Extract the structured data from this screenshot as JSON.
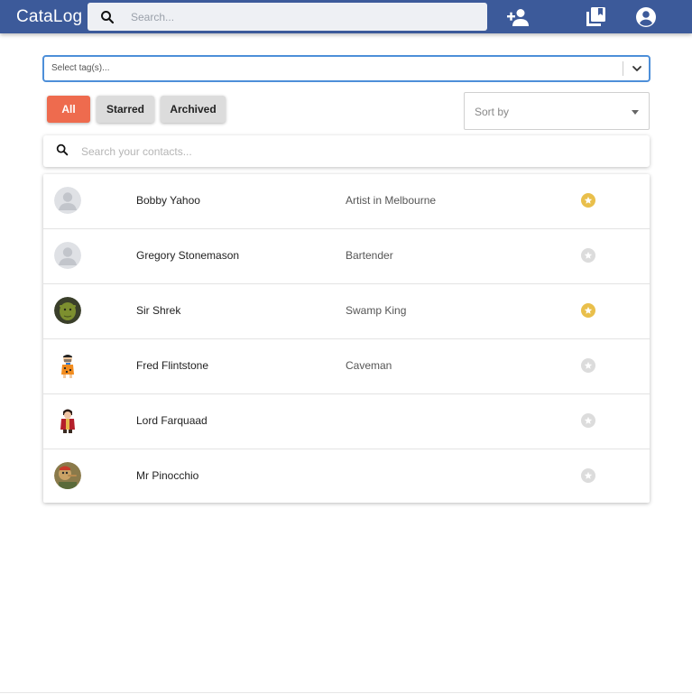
{
  "app": {
    "brand": "CataLog"
  },
  "header": {
    "search_placeholder": "Search...",
    "icons": [
      "add-contact-icon",
      "library-icon",
      "account-circle-icon"
    ]
  },
  "tag_select": {
    "placeholder": "Select tag(s)..."
  },
  "filters": {
    "all": "All",
    "starred": "Starred",
    "archived": "Archived",
    "active": "All"
  },
  "sort": {
    "label": "Sort by"
  },
  "contact_search": {
    "placeholder": "Search your contacts..."
  },
  "contacts": [
    {
      "name": "Bobby Yahoo",
      "description": "Artist in Melbourne",
      "starred": true,
      "avatar": "default-avatar"
    },
    {
      "name": "Gregory Stonemason",
      "description": "Bartender",
      "starred": false,
      "avatar": "default-avatar"
    },
    {
      "name": "Sir Shrek",
      "description": "Swamp King",
      "starred": true,
      "avatar": "shrek-avatar"
    },
    {
      "name": "Fred Flintstone",
      "description": "Caveman",
      "starred": false,
      "avatar": "flintstone-avatar"
    },
    {
      "name": "Lord Farquaad",
      "description": "",
      "starred": false,
      "avatar": "farquaad-avatar"
    },
    {
      "name": "Mr Pinocchio",
      "description": "",
      "starred": false,
      "avatar": "pinocchio-avatar"
    }
  ],
  "colors": {
    "header": "#3c5a9a",
    "accent": "#ee6b4e",
    "focus_border": "#4d8fd9",
    "star_on": "#e9bf4b",
    "star_off": "#dcdcdc"
  }
}
